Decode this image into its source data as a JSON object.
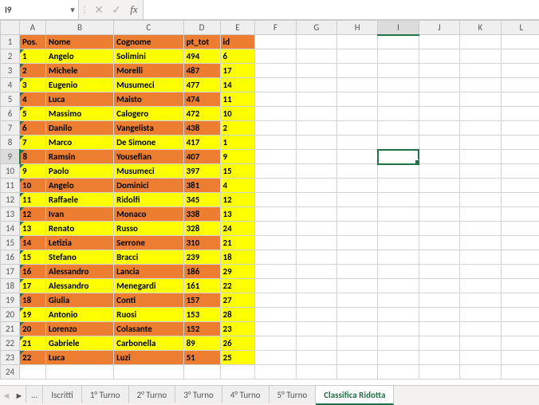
{
  "name_box": "I9",
  "formula_value": "",
  "columns": [
    "A",
    "B",
    "C",
    "D",
    "E",
    "F",
    "G",
    "H",
    "I",
    "J",
    "K",
    "L"
  ],
  "active_col": "I",
  "active_row": 9,
  "headers": {
    "pos": "Pos.",
    "nome": "Nome",
    "cognome": "Cognome",
    "pt": "pt_tot",
    "id": "id"
  },
  "rows": [
    {
      "pos": 1,
      "nome": "Angelo",
      "cognome": "Solimini",
      "pt": 494,
      "id": 6,
      "bg": "y"
    },
    {
      "pos": 2,
      "nome": "Michele",
      "cognome": "Morelli",
      "pt": 487,
      "id": 17,
      "bg": "o"
    },
    {
      "pos": 3,
      "nome": "Eugenio",
      "cognome": "Musumeci",
      "pt": 477,
      "id": 14,
      "bg": "y"
    },
    {
      "pos": 4,
      "nome": "Luca",
      "cognome": "Maisto",
      "pt": 474,
      "id": 11,
      "bg": "o"
    },
    {
      "pos": 5,
      "nome": "Massimo",
      "cognome": "Calogero",
      "pt": 472,
      "id": 10,
      "bg": "y"
    },
    {
      "pos": 6,
      "nome": "Danilo",
      "cognome": "Vangelista",
      "pt": 438,
      "id": 2,
      "bg": "o"
    },
    {
      "pos": 7,
      "nome": "Marco",
      "cognome": "De Simone",
      "pt": 417,
      "id": 1,
      "bg": "y"
    },
    {
      "pos": 8,
      "nome": "Ramsin",
      "cognome": "Yousefian",
      "pt": 407,
      "id": 9,
      "bg": "o"
    },
    {
      "pos": 9,
      "nome": "Paolo",
      "cognome": "Musumeci",
      "pt": 397,
      "id": 15,
      "bg": "y"
    },
    {
      "pos": 10,
      "nome": "Angelo",
      "cognome": "Dominici",
      "pt": 381,
      "id": 4,
      "bg": "o"
    },
    {
      "pos": 11,
      "nome": "Raffaele",
      "cognome": "Ridolfi",
      "pt": 345,
      "id": 12,
      "bg": "y"
    },
    {
      "pos": 12,
      "nome": "Ivan",
      "cognome": "Monaco",
      "pt": 338,
      "id": 13,
      "bg": "o"
    },
    {
      "pos": 13,
      "nome": "Renato",
      "cognome": "Russo",
      "pt": 328,
      "id": 24,
      "bg": "y"
    },
    {
      "pos": 14,
      "nome": "Letizia",
      "cognome": "Serrone",
      "pt": 310,
      "id": 21,
      "bg": "o"
    },
    {
      "pos": 15,
      "nome": "Stefano",
      "cognome": "Bracci",
      "pt": 239,
      "id": 18,
      "bg": "y"
    },
    {
      "pos": 16,
      "nome": "Alessandro",
      "cognome": "Lancia",
      "pt": 186,
      "id": 29,
      "bg": "o"
    },
    {
      "pos": 17,
      "nome": "Alessandro",
      "cognome": "Menegardi",
      "pt": 161,
      "id": 22,
      "bg": "y"
    },
    {
      "pos": 18,
      "nome": "Giulia",
      "cognome": "Conti",
      "pt": 157,
      "id": 27,
      "bg": "o"
    },
    {
      "pos": 19,
      "nome": "Antonio",
      "cognome": "Ruosi",
      "pt": 153,
      "id": 28,
      "bg": "y"
    },
    {
      "pos": 20,
      "nome": "Lorenzo",
      "cognome": "Colasante",
      "pt": 152,
      "id": 23,
      "bg": "o"
    },
    {
      "pos": 21,
      "nome": "Gabriele",
      "cognome": "Carbonella",
      "pt": 89,
      "id": 26,
      "bg": "y"
    },
    {
      "pos": 22,
      "nome": "Luca",
      "cognome": "Luzi",
      "pt": 51,
      "id": 25,
      "bg": "o"
    }
  ],
  "tabs": [
    "...",
    "Iscritti",
    "1° Turno",
    "2° Turno",
    "3° Turno",
    "4° Turno",
    "5° Turno",
    "Classifica Ridotta"
  ],
  "active_tab": "Classifica Ridotta",
  "chart_data": {
    "type": "table",
    "title": "Classifica Ridotta",
    "columns": [
      "Pos.",
      "Nome",
      "Cognome",
      "pt_tot",
      "id"
    ],
    "data": [
      [
        1,
        "Angelo",
        "Solimini",
        494,
        6
      ],
      [
        2,
        "Michele",
        "Morelli",
        487,
        17
      ],
      [
        3,
        "Eugenio",
        "Musumeci",
        477,
        14
      ],
      [
        4,
        "Luca",
        "Maisto",
        474,
        11
      ],
      [
        5,
        "Massimo",
        "Calogero",
        472,
        10
      ],
      [
        6,
        "Danilo",
        "Vangelista",
        438,
        2
      ],
      [
        7,
        "Marco",
        "De Simone",
        417,
        1
      ],
      [
        8,
        "Ramsin",
        "Yousefian",
        407,
        9
      ],
      [
        9,
        "Paolo",
        "Musumeci",
        397,
        15
      ],
      [
        10,
        "Angelo",
        "Dominici",
        381,
        4
      ],
      [
        11,
        "Raffaele",
        "Ridolfi",
        345,
        12
      ],
      [
        12,
        "Ivan",
        "Monaco",
        338,
        13
      ],
      [
        13,
        "Renato",
        "Russo",
        328,
        24
      ],
      [
        14,
        "Letizia",
        "Serrone",
        310,
        21
      ],
      [
        15,
        "Stefano",
        "Bracci",
        239,
        18
      ],
      [
        16,
        "Alessandro",
        "Lancia",
        186,
        29
      ],
      [
        17,
        "Alessandro",
        "Menegardi",
        161,
        22
      ],
      [
        18,
        "Giulia",
        "Conti",
        157,
        27
      ],
      [
        19,
        "Antonio",
        "Ruosi",
        153,
        28
      ],
      [
        20,
        "Lorenzo",
        "Colasante",
        152,
        23
      ],
      [
        21,
        "Gabriele",
        "Carbonella",
        89,
        26
      ],
      [
        22,
        "Luca",
        "Luzi",
        51,
        25
      ]
    ]
  }
}
